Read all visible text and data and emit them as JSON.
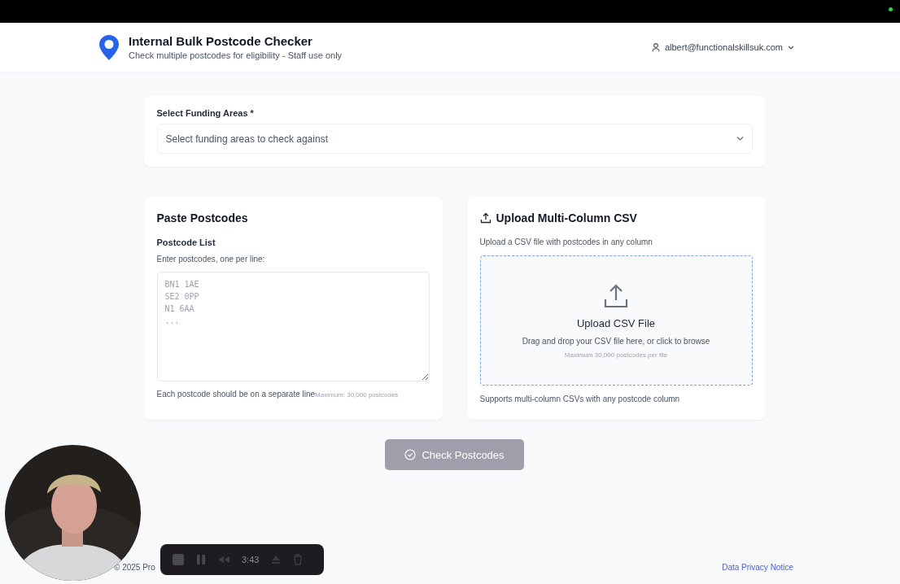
{
  "header": {
    "title": "Internal Bulk Postcode Checker",
    "subtitle": "Check multiple postcodes for eligibility - Staff use only",
    "user": "albert@functionalskillsuk.com"
  },
  "funding": {
    "label": "Select Funding Areas *",
    "placeholder": "Select funding areas to check against"
  },
  "paste": {
    "title": "Paste Postcodes",
    "label": "Postcode List",
    "hint": "Enter postcodes, one per line:",
    "placeholder": "BN1 1AE\nSE2 0PP\nN1 6AA\n...",
    "help": "Each postcode should be on a separate line",
    "limit": "Maximum: 30,000 postcodes"
  },
  "upload": {
    "title": "Upload Multi-Column CSV",
    "description": "Upload a CSV file with postcodes in any column",
    "drop_title": "Upload CSV File",
    "drop_text": "Drag and drop your CSV file here, or click to browse",
    "drop_limit": "Maximum 30,000 postcodes per file",
    "note": "Supports multi-column CSVs with any postcode column"
  },
  "check_button": {
    "label": "Check Postcodes",
    "disabled": true
  },
  "footer": {
    "copyright": "© 2025 Pro",
    "link": "Data Privacy Notice"
  },
  "recorder": {
    "time": "3:43"
  }
}
